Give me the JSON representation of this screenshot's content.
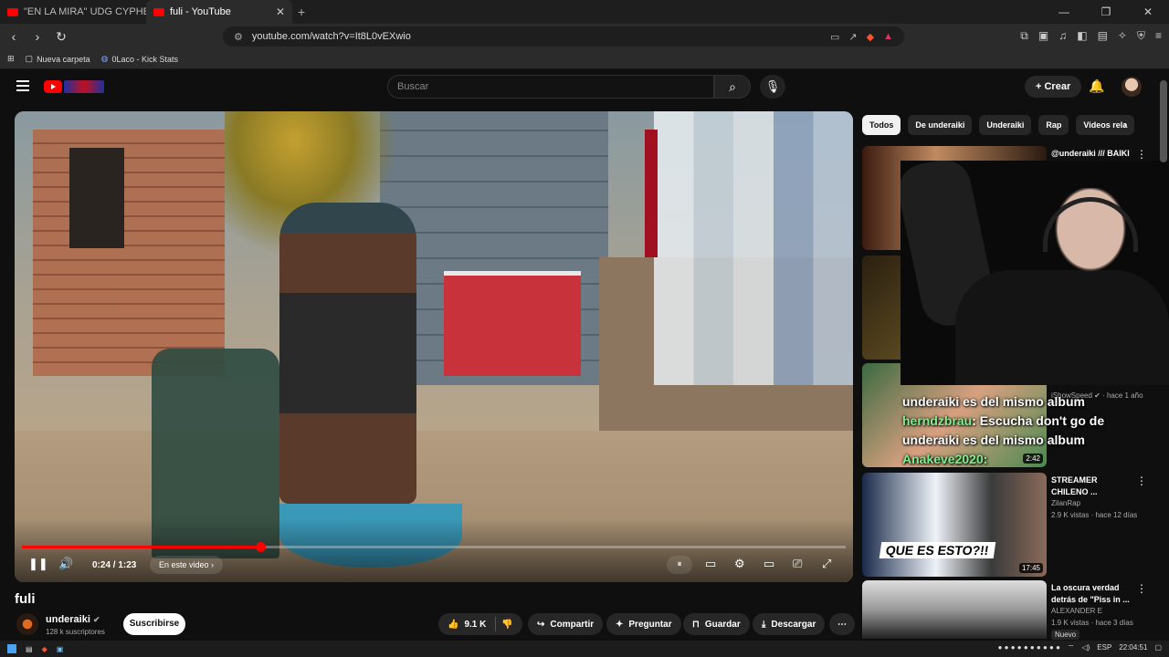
{
  "browser": {
    "tabs": [
      {
        "label": "\"EN LA MIRA\" UDG CYPHER URUGUA"
      },
      {
        "label": "fuli - YouTube"
      }
    ],
    "url": "youtube.com/watch?v=It8L0vEXwio",
    "bookmarks": [
      "Nueva carpeta",
      "0Laco - Kick Stats"
    ]
  },
  "header": {
    "search_placeholder": "Buscar",
    "create_label": "Crear"
  },
  "player": {
    "time": "0:24 / 1:23",
    "chapter_label": "En este video",
    "progress_fraction": 0.289
  },
  "video": {
    "title": "fuli",
    "channel": "underaiki",
    "subscribers": "128 k suscriptores",
    "subscribe_label": "Suscribirse",
    "likes": "9.1 K",
    "share_label": "Compartir",
    "ask_label": "Preguntar",
    "save_label": "Guardar",
    "download_label": "Descargar"
  },
  "chips": [
    "Todos",
    "De underaiki",
    "Underaiki",
    "Rap",
    "Videos rela"
  ],
  "recommendations": [
    {
      "title": "@underaiki /// BAIKI",
      "meta1": "",
      "meta2": "",
      "duration": ""
    },
    {
      "title": "",
      "meta1": "",
      "meta2": "",
      "duration": ""
    },
    {
      "title": "",
      "meta1": "iShowSpeed",
      "meta2": "hace 1 año",
      "duration": "2:42"
    },
    {
      "title": "STREAMER CHILENO ...",
      "meta1": "ZilanRap",
      "meta2": "2.9 K vistas · hace 12 días",
      "duration": "17:45",
      "thumb_text": "QUE ES ESTO?!!"
    },
    {
      "title": "La oscura verdad detrás de \"Piss in ...",
      "meta1": "ALEXANDER E",
      "meta2": "1.9 K vistas · hace 3 días",
      "badge": "Nuevo",
      "duration": ""
    }
  ],
  "chat": {
    "line1": "underaiki es del mismo album",
    "user": "herndzbrau",
    "message": ": Escucha don't go de underaiki es del mismo album",
    "user2": "Anakeve2020:"
  },
  "taskbar": {
    "lang": "ESP",
    "clock": "22:04:51"
  },
  "colors": {
    "accent": "#ff0000",
    "background": "#0f0f0f",
    "chat_name": "#7cf08c"
  }
}
